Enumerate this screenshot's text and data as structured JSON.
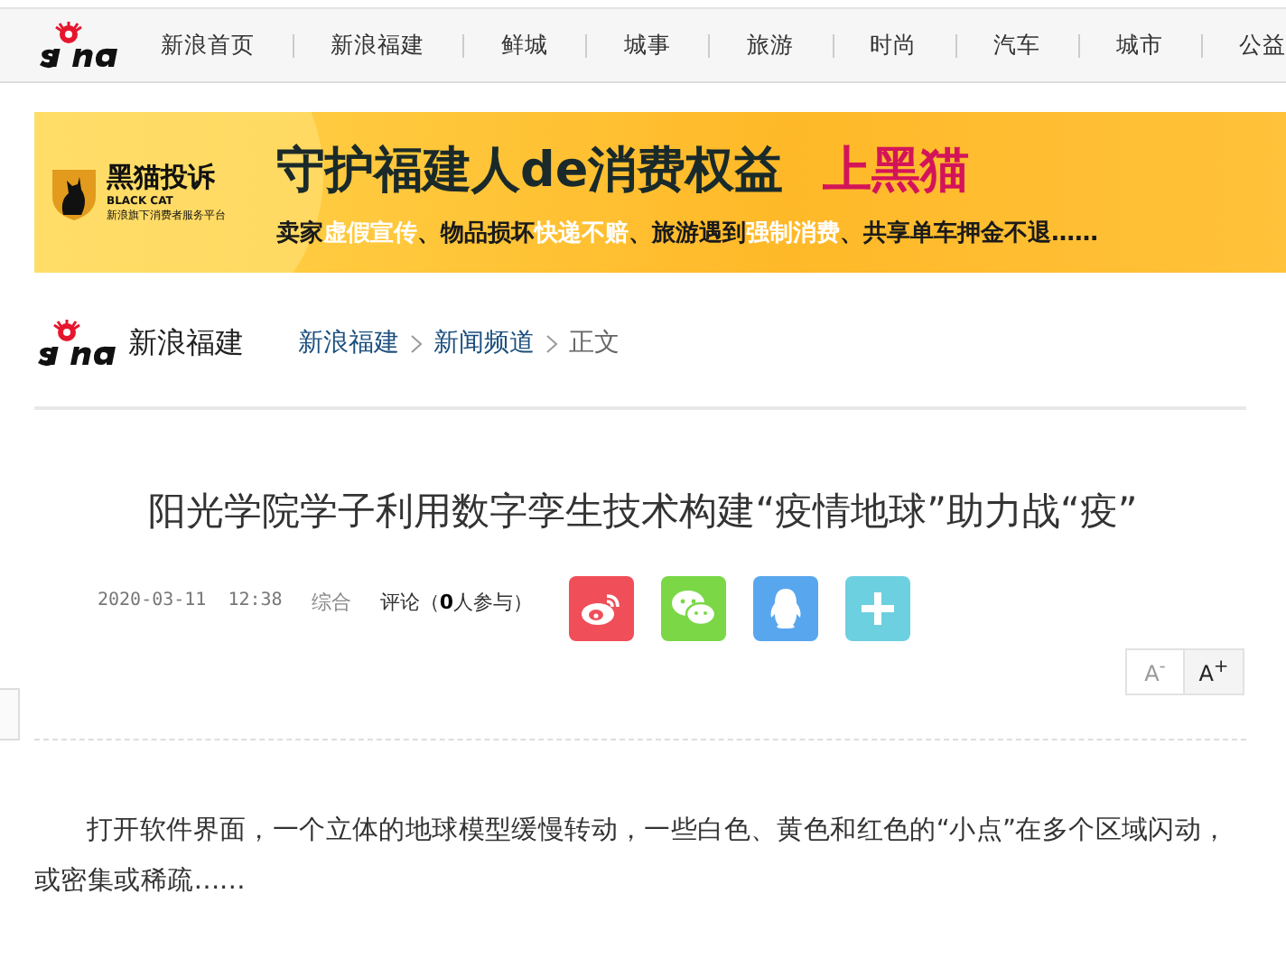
{
  "top_nav": {
    "items": [
      {
        "label": "新浪首页"
      },
      {
        "label": "新浪福建"
      },
      {
        "label": "鲜城"
      },
      {
        "label": "城事"
      },
      {
        "label": "旅游"
      },
      {
        "label": "时尚"
      },
      {
        "label": "汽车"
      },
      {
        "label": "城市"
      },
      {
        "label": "公益"
      }
    ]
  },
  "banner": {
    "brand": "黑猫投诉",
    "brand_en": "BLACK CAT",
    "brand_sub": "新浪旗下消费者服务平台",
    "headline": "守护福建人de消费权益",
    "headline_2": "上黑猫",
    "subline": [
      {
        "text": "卖家",
        "highlight": false
      },
      {
        "text": "虚假宣传",
        "highlight": true
      },
      {
        "text": "、物品损坏",
        "highlight": false
      },
      {
        "text": "快递不赔",
        "highlight": true
      },
      {
        "text": "、旅游遇到",
        "highlight": false
      },
      {
        "text": "强制消费",
        "highlight": true
      },
      {
        "text": "、共享单车押金不退……",
        "highlight": false
      }
    ]
  },
  "channel": {
    "name": "新浪福建",
    "breadcrumb": [
      {
        "label": "新浪福建",
        "link": true
      },
      {
        "label": "新闻频道",
        "link": true
      },
      {
        "label": "正文",
        "link": false
      }
    ]
  },
  "article": {
    "title": "阳光学院学子利用数字孪生技术构建“疫情地球”助力战“疫”",
    "date": "2020-03-11",
    "time": "12:38",
    "source": "综合",
    "comments": "评论（**0**人参与）",
    "share": [
      {
        "kind": "weibo"
      },
      {
        "kind": "wechat"
      },
      {
        "kind": "qq"
      },
      {
        "kind": "more"
      }
    ],
    "font_buttons": [
      {
        "label": "A",
        "sign": "-",
        "disabled": true
      },
      {
        "label": "A",
        "sign": "+",
        "disabled": false
      }
    ],
    "body": "打开软件界面，一个立体的地球模型缓慢转动，一些白色、黄色和红色的“小点”在多个区域闪动，或密集或稀疏……"
  }
}
